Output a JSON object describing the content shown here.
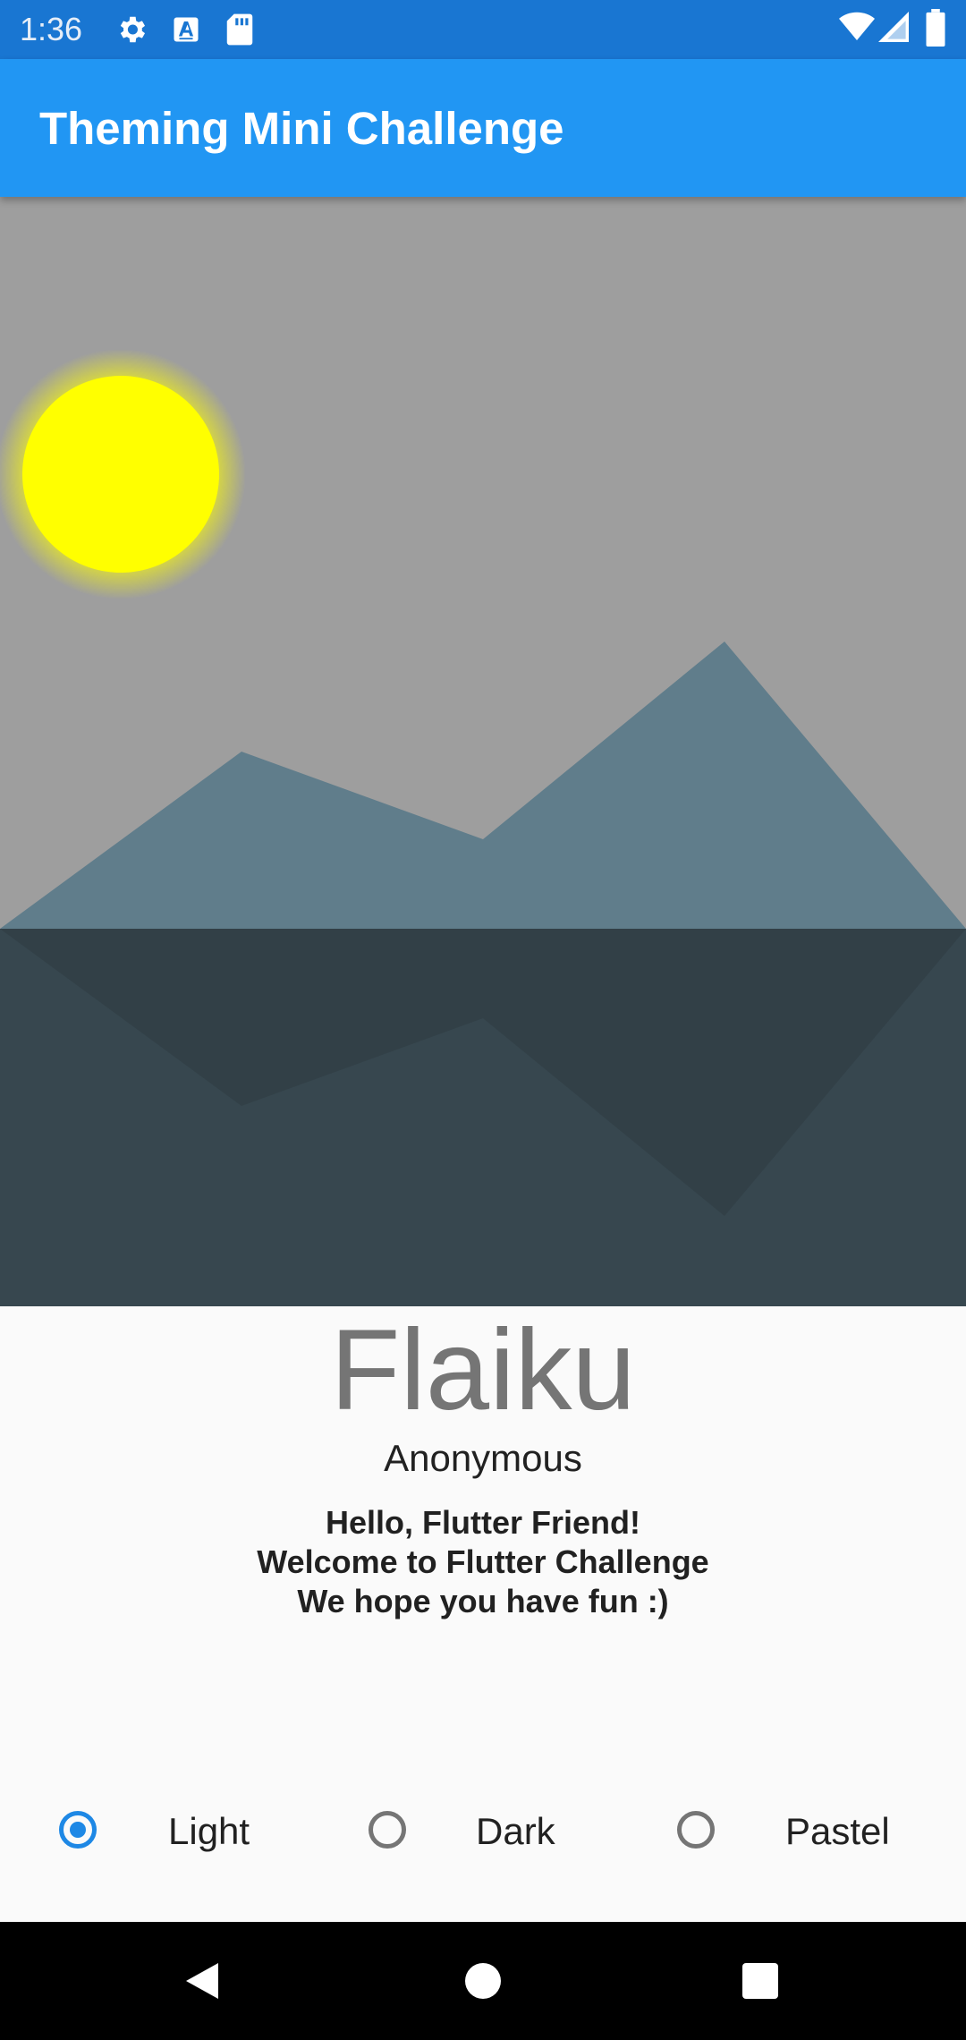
{
  "status_bar": {
    "time": "1:36",
    "left_icons": [
      "gear-icon",
      "text-a-icon",
      "sd-card-icon"
    ],
    "right_icons": [
      "wifi-icon",
      "cell-signal-icon",
      "battery-icon"
    ],
    "color": "#1976d2"
  },
  "app_bar": {
    "title": "Theming Mini Challenge",
    "color": "#2196f3"
  },
  "scene": {
    "sky_color": "#9e9e9e",
    "sun_color": "#ffff00",
    "mountain_color": "#607d8b",
    "water_color": "#37474f",
    "reflection_color": "#324047"
  },
  "content": {
    "title": "Flaiku",
    "author": "Anonymous",
    "lines": [
      "Hello, Flutter Friend!",
      "Welcome to Flutter Challenge",
      "We hope you have fun :)"
    ]
  },
  "theme_options": {
    "selected": "Light",
    "options": [
      {
        "label": "Light",
        "selected": true
      },
      {
        "label": "Dark",
        "selected": false
      },
      {
        "label": "Pastel",
        "selected": false
      }
    ],
    "accent": "#1e88e5"
  },
  "nav_bar": {
    "buttons": [
      "back-icon",
      "home-icon",
      "recents-icon"
    ]
  }
}
